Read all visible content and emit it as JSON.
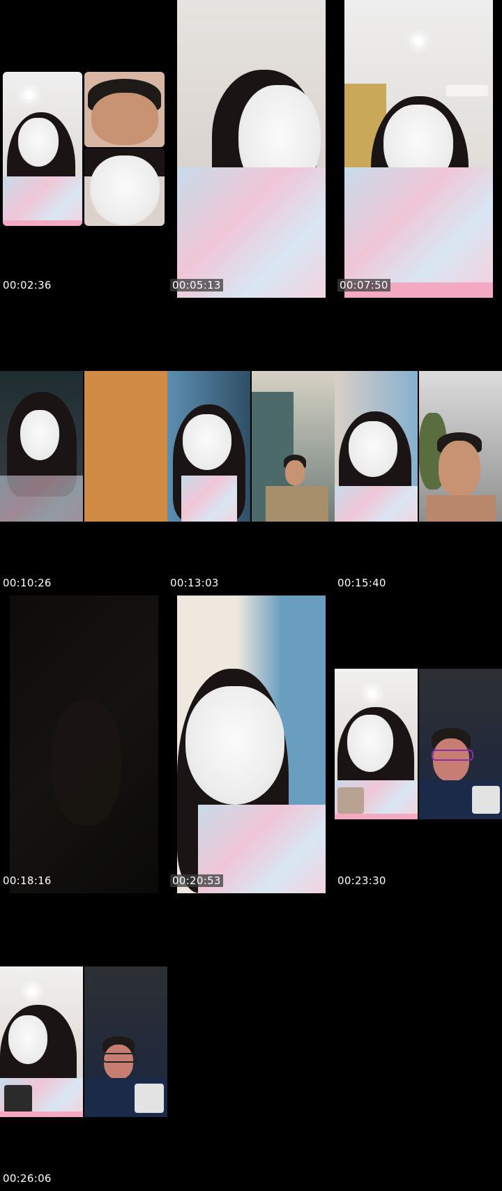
{
  "grid": {
    "cells": [
      {
        "timestamp": "00:02:36",
        "scene": "split-call-with-thumbnails"
      },
      {
        "timestamp": "00:05:13",
        "scene": "selfie-closeup"
      },
      {
        "timestamp": "00:07:50",
        "scene": "selfie-room"
      },
      {
        "timestamp": "00:10:26",
        "scene": "dark-split-orange"
      },
      {
        "timestamp": "00:13:03",
        "scene": "split-call-male-doorway"
      },
      {
        "timestamp": "00:15:40",
        "scene": "split-call-male-outdoor"
      },
      {
        "timestamp": "00:18:16",
        "scene": "dark-frame"
      },
      {
        "timestamp": "00:20:53",
        "scene": "selfie-eyes-closed"
      },
      {
        "timestamp": "00:23:30",
        "scene": "split-call-glasses"
      },
      {
        "timestamp": "00:26:06",
        "scene": "split-call-glasses-2"
      }
    ]
  },
  "colors": {
    "background": "#000000",
    "mask_white": "#f2f2f2",
    "pink_bar": "#f3a9c2",
    "orange_panel": "#d18b44",
    "curtain_blue": "#6a9ec0"
  }
}
